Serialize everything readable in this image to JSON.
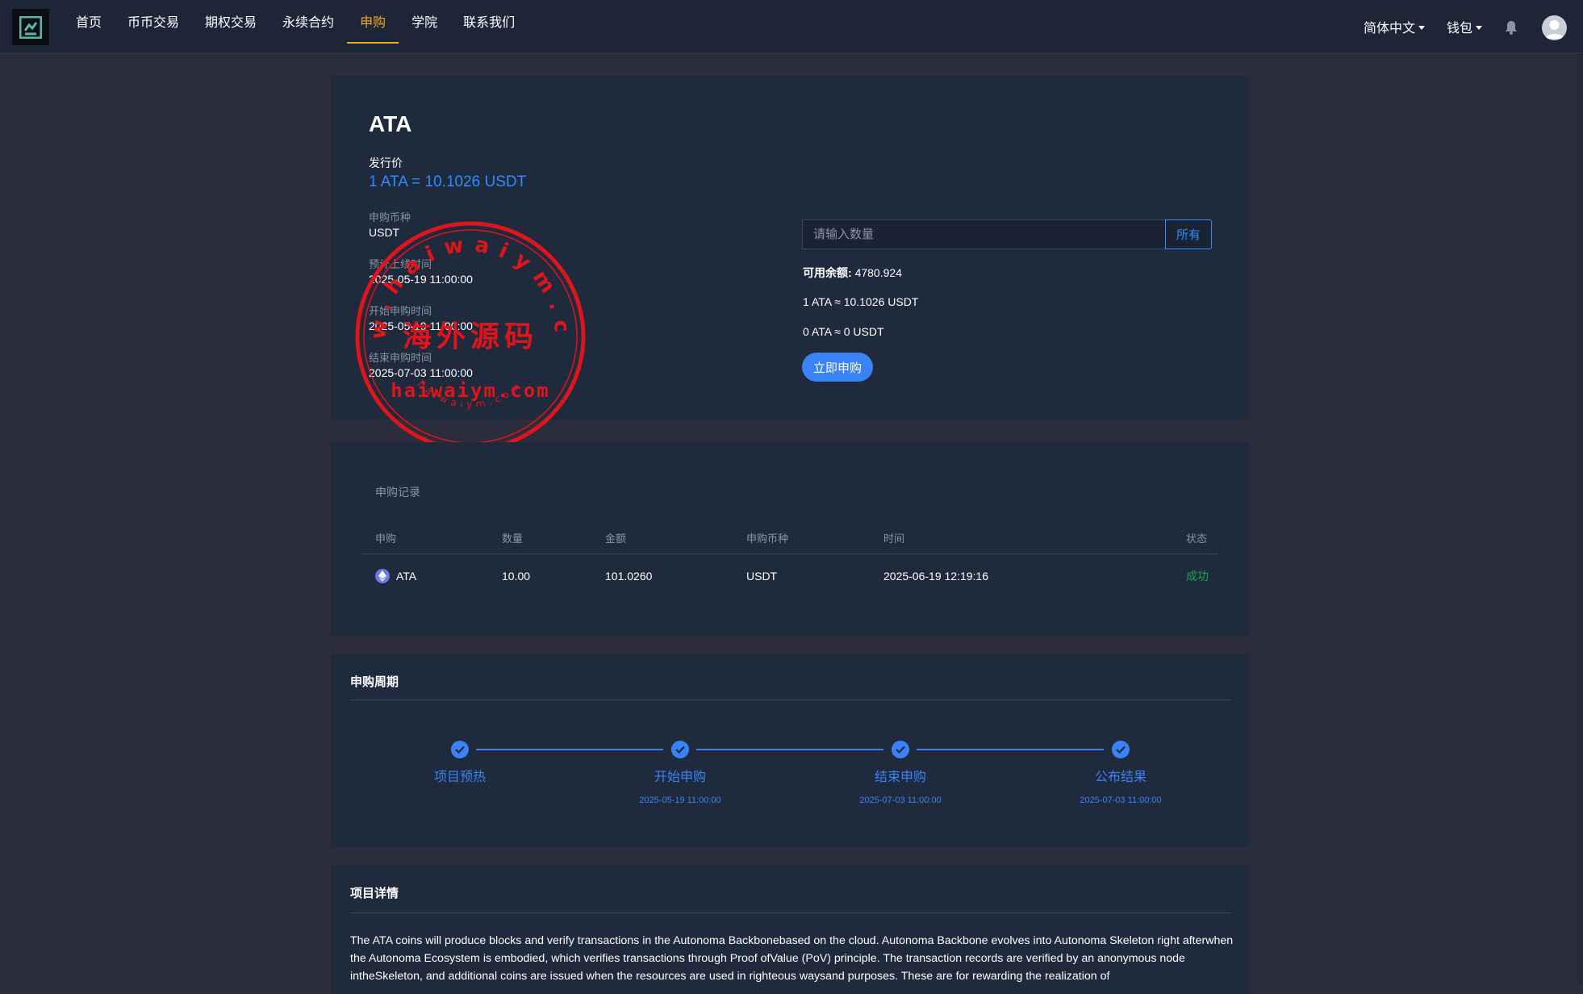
{
  "nav": {
    "items": [
      "首页",
      "币币交易",
      "期权交易",
      "永续合约",
      "申购",
      "学院",
      "联系我们"
    ],
    "active_index": 4,
    "language": "简体中文",
    "wallet": "钱包"
  },
  "product": {
    "name": "ATA",
    "issue_price_label": "发行价",
    "issue_price": "1 ATA = 10.1026 USDT",
    "info": [
      {
        "label": "申购币种",
        "value": "USDT"
      },
      {
        "label": "预计上线时间",
        "value": "2025-05-19 11:00:00"
      },
      {
        "label": "开始申购时间",
        "value": "2025-05-19 11:00:00"
      },
      {
        "label": "结束申购时间",
        "value": "2025-07-03 11:00:00"
      }
    ]
  },
  "form": {
    "placeholder": "请输入数量",
    "all_button": "所有",
    "balance_label": "可用余额:",
    "balance_value": "4780.924",
    "rate_line": "1 ATA ≈ 10.1026 USDT",
    "estimate_line": "0 ATA ≈ 0 USDT",
    "submit": "立即申购"
  },
  "stamp": {
    "top_arc": "www.haiwaiym.com",
    "center": "海外源码",
    "bottom_main": "haiwaiym.com",
    "bottom_arc": "haiwaiym.com"
  },
  "records": {
    "title": "申购记录",
    "headers": [
      "申购",
      "数量",
      "金额",
      "申购币种",
      "时间",
      "状态"
    ],
    "rows": [
      {
        "coin": "ATA",
        "quantity": "10.00",
        "amount": "101.0260",
        "currency": "USDT",
        "time": "2025-06-19 12:19:16",
        "status": "成功"
      }
    ]
  },
  "cycle": {
    "title": "申购周期",
    "steps": [
      {
        "label": "项目预热",
        "date": ""
      },
      {
        "label": "开始申购",
        "date": "2025-05-19 11:00:00"
      },
      {
        "label": "结束申购",
        "date": "2025-07-03 11:00:00"
      },
      {
        "label": "公布结果",
        "date": "2025-07-03 11:00:00"
      }
    ]
  },
  "detail": {
    "title": "项目详情",
    "text": "The ATA coins will produce blocks and verify transactions in the Autonoma Backbonebased on the cloud. Autonoma Backbone evolves into Autonoma Skeleton right afterwhen the Autonoma Ecosystem is embodied, which verifies transactions through Proof ofValue (PoV) principle. The transaction records are verified by an anonymous node intheSkeleton, and additional coins are issued when the resources are used in righteous waysand purposes. These are for rewarding the realization of"
  },
  "colors": {
    "accent_blue": "#3b82f6",
    "active_nav": "#f5a623",
    "success": "#19a34a",
    "stamp_red": "#e0141b"
  }
}
